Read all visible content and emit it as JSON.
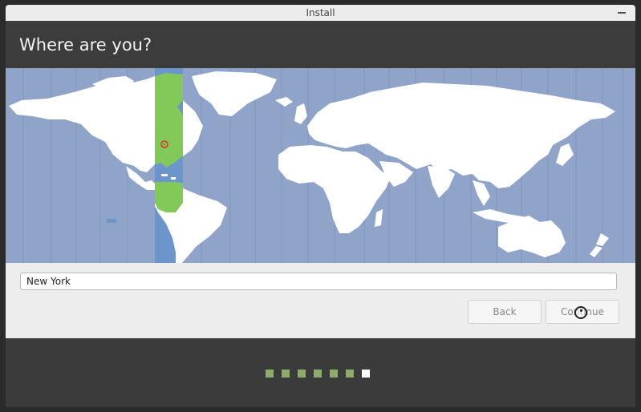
{
  "window": {
    "title": "Install"
  },
  "page": {
    "heading": "Where are you?"
  },
  "location": {
    "value": "New York"
  },
  "buttons": {
    "back": "Back",
    "continue": "Continue"
  },
  "progress": {
    "total_steps": 7,
    "current_step": 7
  },
  "colors": {
    "ocean": "#8fa4c8",
    "land": "#ffffff",
    "selected_timezone": "#6c95cb",
    "selected_land": "#82c95a",
    "step_done": "#8cab6c",
    "step_current": "#ffffff"
  }
}
